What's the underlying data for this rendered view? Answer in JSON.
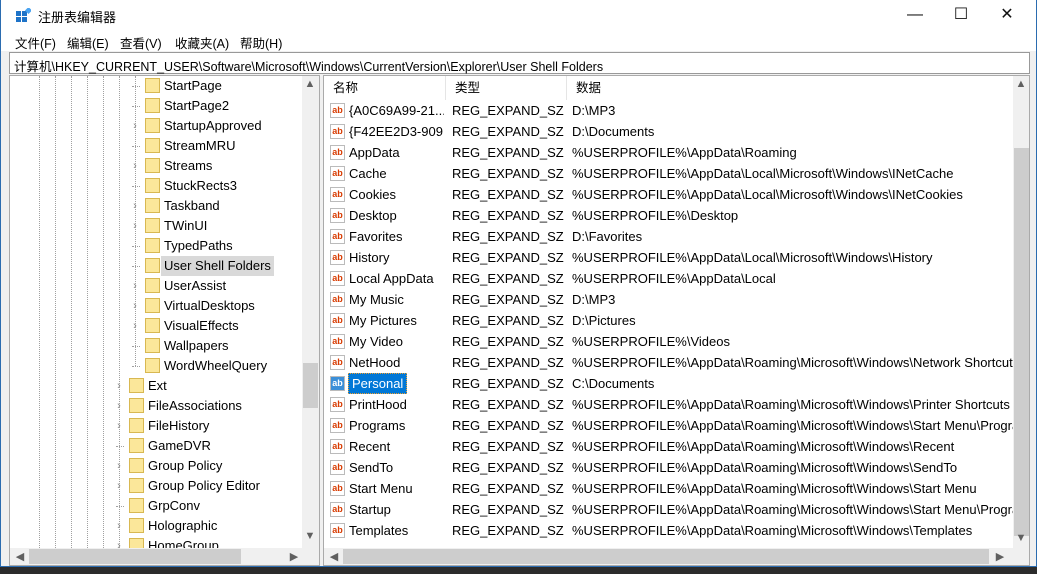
{
  "window": {
    "title": "注册表编辑器",
    "minimize": "—",
    "maximize": "☐",
    "close": "✕",
    "accent": "#0078d7"
  },
  "menu": [
    "文件(F)",
    "编辑(E)",
    "查看(V)",
    "收藏夹(A)",
    "帮助(H)"
  ],
  "address": "计算机\\HKEY_CURRENT_USER\\Software\\Microsoft\\Windows\\CurrentVersion\\Explorer\\User Shell Folders",
  "tree": [
    {
      "label": "StartPage",
      "level": 2,
      "expandable": false
    },
    {
      "label": "StartPage2",
      "level": 2,
      "expandable": false
    },
    {
      "label": "StartupApproved",
      "level": 2,
      "expandable": true
    },
    {
      "label": "StreamMRU",
      "level": 2,
      "expandable": false
    },
    {
      "label": "Streams",
      "level": 2,
      "expandable": true
    },
    {
      "label": "StuckRects3",
      "level": 2,
      "expandable": false
    },
    {
      "label": "Taskband",
      "level": 2,
      "expandable": true
    },
    {
      "label": "TWinUI",
      "level": 2,
      "expandable": true
    },
    {
      "label": "TypedPaths",
      "level": 2,
      "expandable": false
    },
    {
      "label": "User Shell Folders",
      "level": 2,
      "expandable": false,
      "selected": true
    },
    {
      "label": "UserAssist",
      "level": 2,
      "expandable": true
    },
    {
      "label": "VirtualDesktops",
      "level": 2,
      "expandable": true
    },
    {
      "label": "VisualEffects",
      "level": 2,
      "expandable": true
    },
    {
      "label": "Wallpapers",
      "level": 2,
      "expandable": false
    },
    {
      "label": "WordWheelQuery",
      "level": 2,
      "expandable": false
    },
    {
      "label": "Ext",
      "level": 1,
      "expandable": true
    },
    {
      "label": "FileAssociations",
      "level": 1,
      "expandable": true
    },
    {
      "label": "FileHistory",
      "level": 1,
      "expandable": true
    },
    {
      "label": "GameDVR",
      "level": 1,
      "expandable": false
    },
    {
      "label": "Group Policy",
      "level": 1,
      "expandable": true
    },
    {
      "label": "Group Policy Editor",
      "level": 1,
      "expandable": true
    },
    {
      "label": "GrpConv",
      "level": 1,
      "expandable": false
    },
    {
      "label": "Holographic",
      "level": 1,
      "expandable": true
    },
    {
      "label": "HomeGroup",
      "level": 1,
      "expandable": true
    }
  ],
  "columns": [
    "名称",
    "类型",
    "数据"
  ],
  "values": [
    {
      "name": "{A0C69A99-21...",
      "type": "REG_EXPAND_SZ",
      "data": "D:\\MP3"
    },
    {
      "name": "{F42EE2D3-909...",
      "type": "REG_EXPAND_SZ",
      "data": "D:\\Documents"
    },
    {
      "name": "AppData",
      "type": "REG_EXPAND_SZ",
      "data": "%USERPROFILE%\\AppData\\Roaming"
    },
    {
      "name": "Cache",
      "type": "REG_EXPAND_SZ",
      "data": "%USERPROFILE%\\AppData\\Local\\Microsoft\\Windows\\INetCache"
    },
    {
      "name": "Cookies",
      "type": "REG_EXPAND_SZ",
      "data": "%USERPROFILE%\\AppData\\Local\\Microsoft\\Windows\\INetCookies"
    },
    {
      "name": "Desktop",
      "type": "REG_EXPAND_SZ",
      "data": "%USERPROFILE%\\Desktop"
    },
    {
      "name": "Favorites",
      "type": "REG_EXPAND_SZ",
      "data": "D:\\Favorites"
    },
    {
      "name": "History",
      "type": "REG_EXPAND_SZ",
      "data": "%USERPROFILE%\\AppData\\Local\\Microsoft\\Windows\\History"
    },
    {
      "name": "Local AppData",
      "type": "REG_EXPAND_SZ",
      "data": "%USERPROFILE%\\AppData\\Local"
    },
    {
      "name": "My Music",
      "type": "REG_EXPAND_SZ",
      "data": "D:\\MP3"
    },
    {
      "name": "My Pictures",
      "type": "REG_EXPAND_SZ",
      "data": "D:\\Pictures"
    },
    {
      "name": "My Video",
      "type": "REG_EXPAND_SZ",
      "data": "%USERPROFILE%\\Videos"
    },
    {
      "name": "NetHood",
      "type": "REG_EXPAND_SZ",
      "data": "%USERPROFILE%\\AppData\\Roaming\\Microsoft\\Windows\\Network Shortcuts"
    },
    {
      "name": "Personal",
      "type": "REG_EXPAND_SZ",
      "data": "C:\\Documents",
      "selected": true
    },
    {
      "name": "PrintHood",
      "type": "REG_EXPAND_SZ",
      "data": "%USERPROFILE%\\AppData\\Roaming\\Microsoft\\Windows\\Printer Shortcuts"
    },
    {
      "name": "Programs",
      "type": "REG_EXPAND_SZ",
      "data": "%USERPROFILE%\\AppData\\Roaming\\Microsoft\\Windows\\Start Menu\\Programs"
    },
    {
      "name": "Recent",
      "type": "REG_EXPAND_SZ",
      "data": "%USERPROFILE%\\AppData\\Roaming\\Microsoft\\Windows\\Recent"
    },
    {
      "name": "SendTo",
      "type": "REG_EXPAND_SZ",
      "data": "%USERPROFILE%\\AppData\\Roaming\\Microsoft\\Windows\\SendTo"
    },
    {
      "name": "Start Menu",
      "type": "REG_EXPAND_SZ",
      "data": "%USERPROFILE%\\AppData\\Roaming\\Microsoft\\Windows\\Start Menu"
    },
    {
      "name": "Startup",
      "type": "REG_EXPAND_SZ",
      "data": "%USERPROFILE%\\AppData\\Roaming\\Microsoft\\Windows\\Start Menu\\Programs\\Startup"
    },
    {
      "name": "Templates",
      "type": "REG_EXPAND_SZ",
      "data": "%USERPROFILE%\\AppData\\Roaming\\Microsoft\\Windows\\Templates"
    }
  ],
  "value_icon": "ab"
}
